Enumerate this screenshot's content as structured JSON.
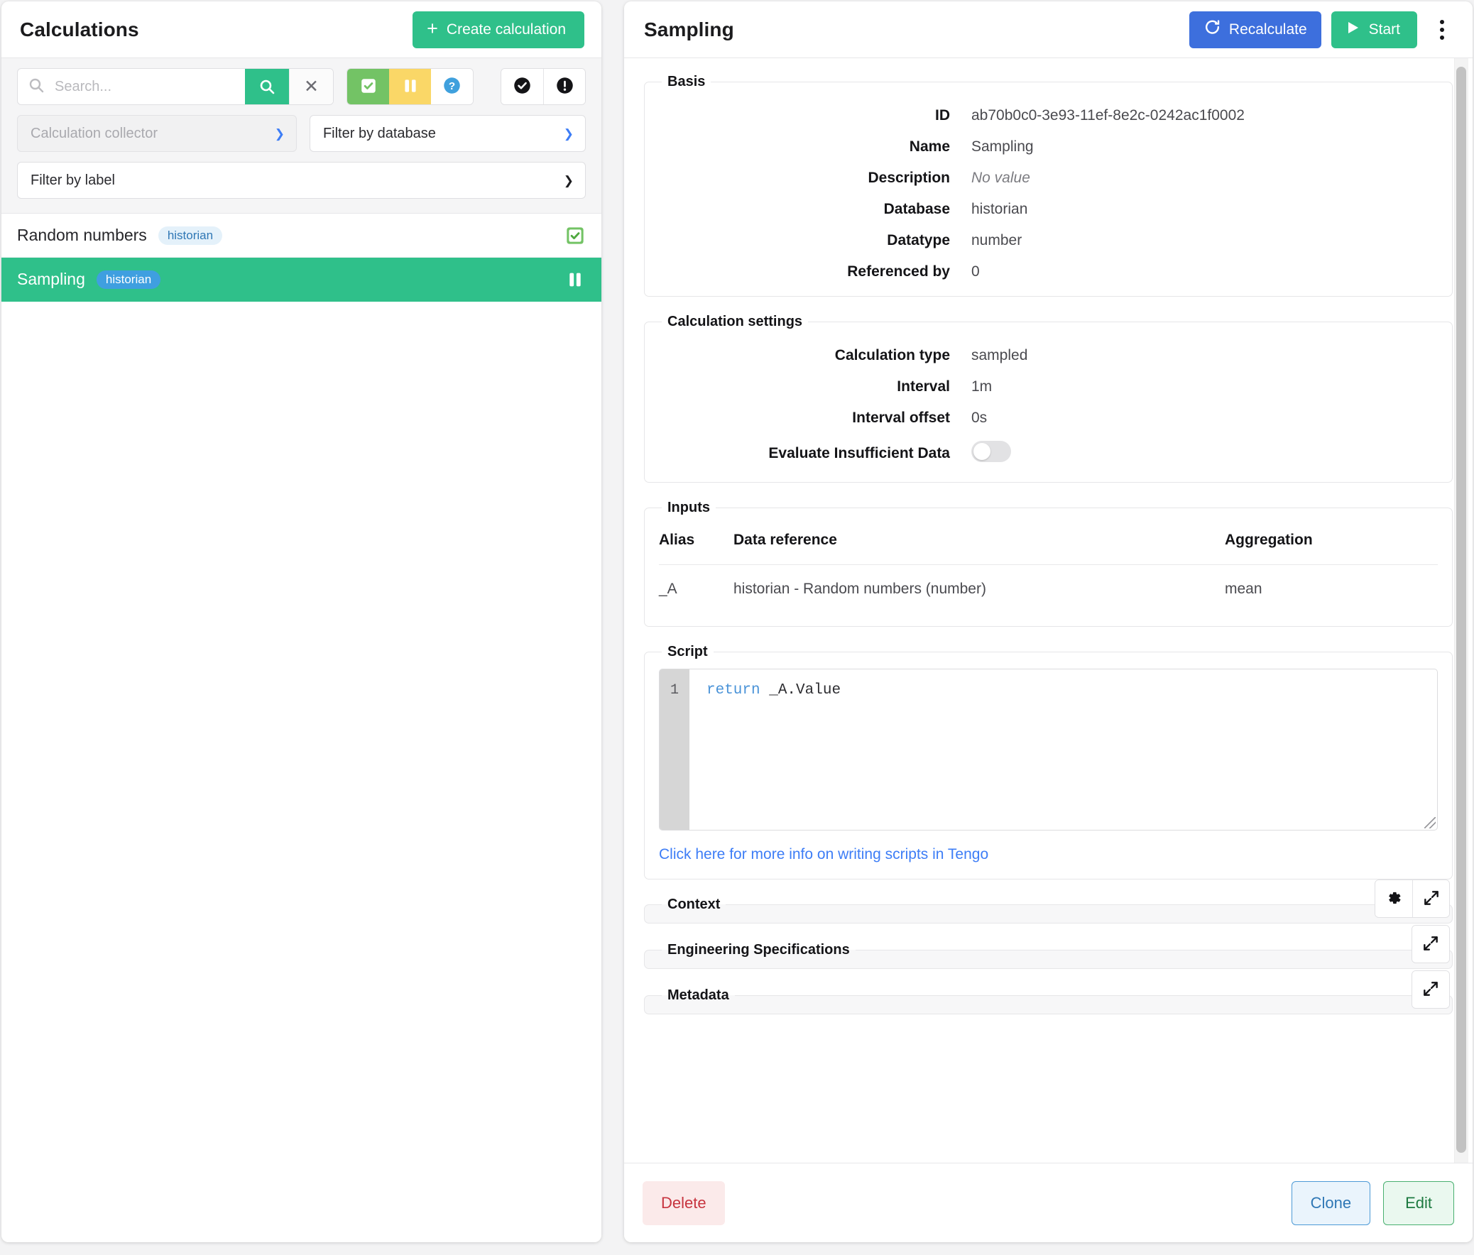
{
  "left": {
    "title": "Calculations",
    "create_button": "Create calculation",
    "search": {
      "placeholder": "Search...",
      "value": "",
      "search_icon": "search-icon",
      "clear_icon": "close-icon"
    },
    "toggles": [
      {
        "name": "active-filter",
        "icon": "check-square-icon",
        "color": "#73c365",
        "active": true
      },
      {
        "name": "paused-filter",
        "icon": "pause-icon",
        "color": "#fad767",
        "active": true
      },
      {
        "name": "unknown-filter",
        "icon": "question-circle-icon",
        "color": "#ffffff",
        "active": false
      }
    ],
    "status_buttons": [
      {
        "name": "ok-status-filter",
        "icon": "check-circle-icon"
      },
      {
        "name": "error-status-filter",
        "icon": "exclamation-circle-icon"
      }
    ],
    "filters": {
      "collector": {
        "label": "Calculation collector",
        "disabled": true
      },
      "database": {
        "label": "Filter by database",
        "disabled": false
      },
      "label": {
        "label": "Filter by label",
        "disabled": false
      }
    },
    "items": [
      {
        "name": "Random numbers",
        "chip": "historian",
        "state_icon": "check-square-icon",
        "selected": false
      },
      {
        "name": "Sampling",
        "chip": "historian",
        "state_icon": "pause-icon",
        "selected": true
      }
    ]
  },
  "detail": {
    "title": "Sampling",
    "recalculate_button": "Recalculate",
    "start_button": "Start",
    "menu_icon": "kebab-menu-icon",
    "basis": {
      "legend": "Basis",
      "rows": [
        {
          "key": "ID",
          "value": "ab70b0c0-3e93-11ef-8e2c-0242ac1f0002",
          "muted": false
        },
        {
          "key": "Name",
          "value": "Sampling",
          "muted": false
        },
        {
          "key": "Description",
          "value": "No value",
          "muted": true
        },
        {
          "key": "Database",
          "value": "historian",
          "muted": false
        },
        {
          "key": "Datatype",
          "value": "number",
          "muted": false
        },
        {
          "key": "Referenced by",
          "value": "0",
          "muted": false
        }
      ]
    },
    "settings": {
      "legend": "Calculation settings",
      "rows": [
        {
          "key": "Calculation type",
          "value": "sampled"
        },
        {
          "key": "Interval",
          "value": "1m"
        },
        {
          "key": "Interval offset",
          "value": "0s"
        }
      ],
      "toggle_row": {
        "key": "Evaluate Insufficient Data",
        "value": "off"
      }
    },
    "inputs": {
      "legend": "Inputs",
      "columns": [
        "Alias",
        "Data reference",
        "Aggregation"
      ],
      "rows": [
        {
          "alias": "_A",
          "reference": "historian - Random numbers (number)",
          "aggregation": "mean"
        }
      ]
    },
    "script": {
      "legend": "Script",
      "line_number": "1",
      "code_keyword": "return",
      "code_rest": " _A.Value",
      "help_link": "Click here for more info on writing scripts in Tengo"
    },
    "context": {
      "legend": "Context",
      "actions": [
        {
          "name": "settings-button",
          "icon": "gear-icon"
        },
        {
          "name": "expand-button",
          "icon": "expand-arrows-icon"
        }
      ]
    },
    "engineering": {
      "legend": "Engineering Specifications",
      "actions": [
        {
          "name": "expand-button",
          "icon": "expand-arrows-icon"
        }
      ]
    },
    "metadata": {
      "legend": "Metadata",
      "actions": [
        {
          "name": "expand-button",
          "icon": "expand-arrows-icon"
        }
      ]
    },
    "footer": {
      "delete_button": "Delete",
      "clone_button": "Clone",
      "edit_button": "Edit"
    }
  },
  "colors": {
    "accent_green": "#2fc08a",
    "accent_blue": "#3d6fdd",
    "link_blue": "#3d7df6",
    "danger_red": "#c7343f",
    "toggle_green": "#73c365",
    "toggle_yellow": "#fad767"
  }
}
